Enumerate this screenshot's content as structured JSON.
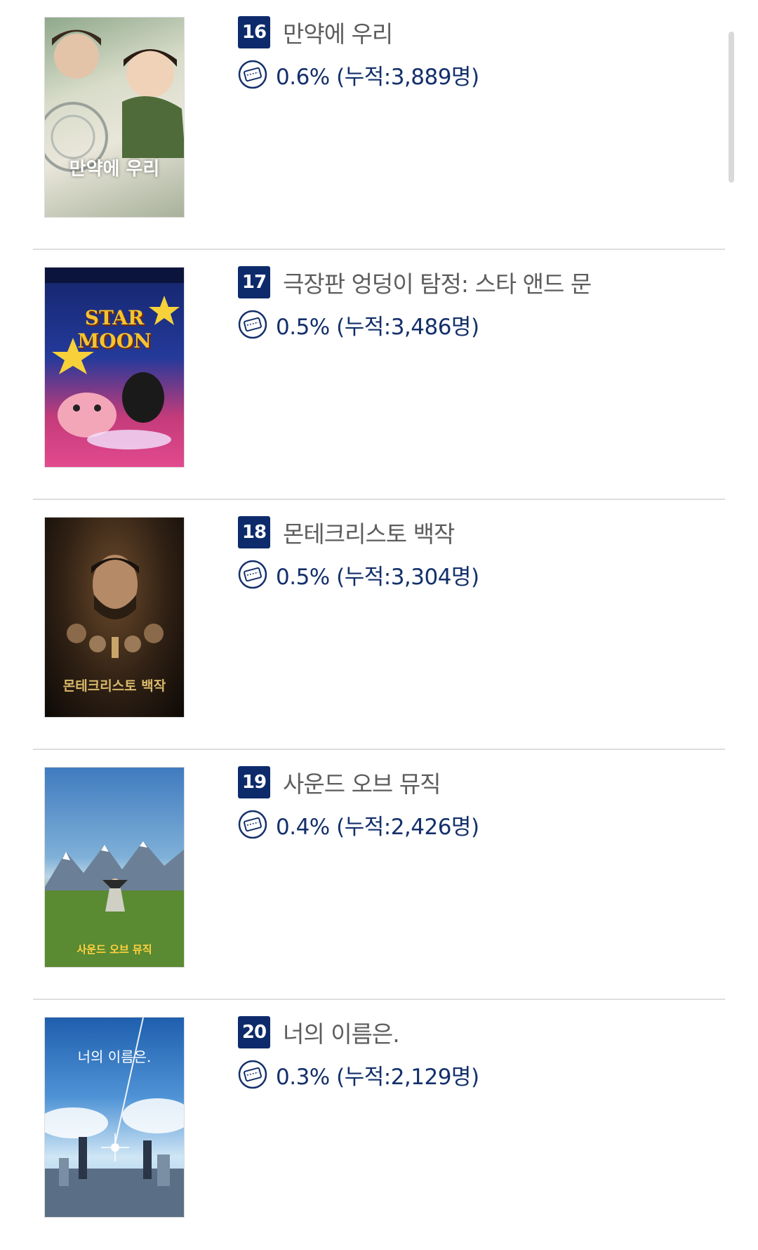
{
  "movies": [
    {
      "rank": "16",
      "title": "만약에 우리",
      "stat": "0.6% (누적:3,889명)",
      "poster_text": "만약에 우리",
      "poster_bg": "#c9d3c7",
      "poster_fg": "#ffffff"
    },
    {
      "rank": "17",
      "title": "극장판 엉덩이 탐정: 스타 앤드 문",
      "stat": "0.5% (누적:3,486명)",
      "poster_text": "STAR MOON",
      "poster_bg": "#1b2a6e",
      "poster_fg": "#f4c430"
    },
    {
      "rank": "18",
      "title": "몬테크리스토 백작",
      "stat": "0.5% (누적:3,304명)",
      "poster_text": "몬테크리스토 백작",
      "poster_bg": "#2a1d12",
      "poster_fg": "#d9b96a"
    },
    {
      "rank": "19",
      "title": "사운드 오브 뮤직",
      "stat": "0.4% (누적:2,426명)",
      "poster_text": "사운드 오브 뮤직",
      "poster_bg": "#4f86c0",
      "poster_fg": "#ffd23f"
    },
    {
      "rank": "20",
      "title": "너의 이름은.",
      "stat": "0.3% (누적:2,129명)",
      "poster_text": "너의 이름은.",
      "poster_bg": "#3a7fc9",
      "poster_fg": "#ffffff"
    }
  ],
  "icons": {
    "ticket": "ticket-icon"
  },
  "colors": {
    "rank_badge": "#0d2b6b",
    "stat_text": "#14306b",
    "title_text": "#5d5d5d"
  }
}
